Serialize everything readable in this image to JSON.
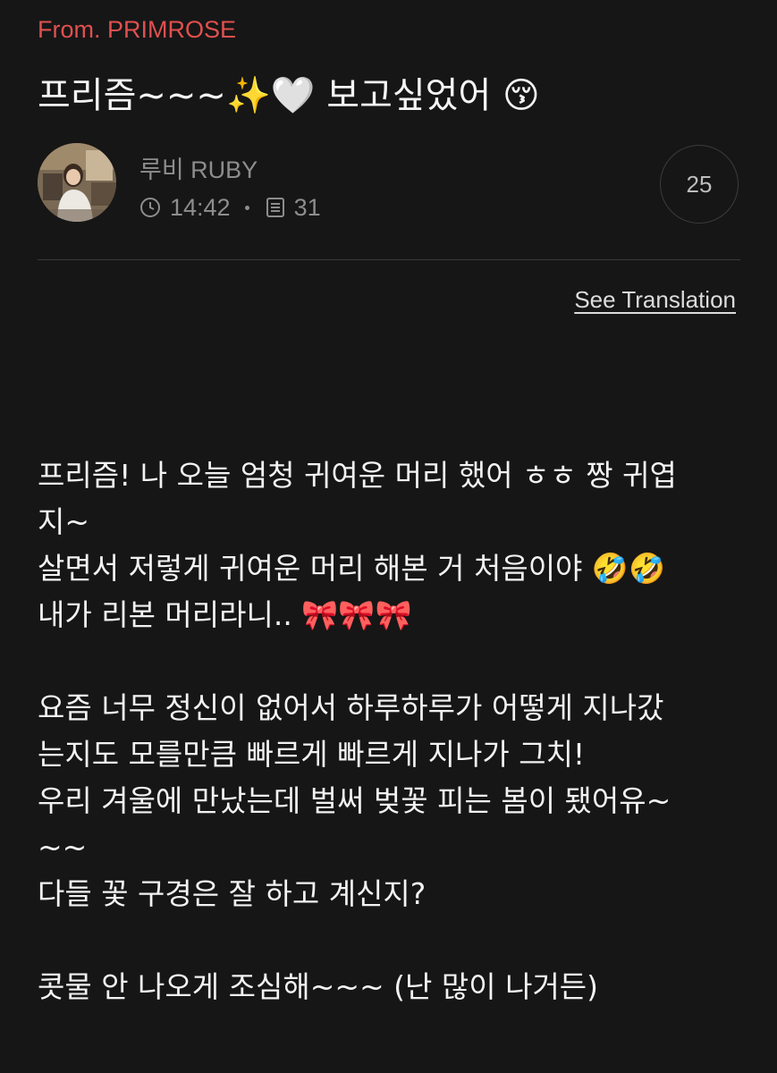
{
  "header": {
    "from_label": "From. PRIMROSE",
    "title": "프리즘~~~✨🤍 보고싶었어 😚"
  },
  "author": {
    "name": "루비 RUBY",
    "time": "14:42",
    "view_count": "31",
    "comment_count": "25"
  },
  "actions": {
    "translate_label": "See Translation"
  },
  "post": {
    "lines": [
      "프리즘! 나 오늘 엄청 귀여운 머리 했어 ㅎㅎ 짱 귀엽",
      "지~",
      "살면서 저렇게 귀여운 머리 해본 거 처음이야 🤣🤣",
      "내가 리본 머리라니.. 🎀🎀🎀",
      "",
      "요즘 너무 정신이 없어서 하루하루가 어떻게 지나갔",
      "는지도 모를만큼 빠르게 빠르게 지나가 그치!",
      "우리 겨울에 만났는데 벌써 벚꽃 피는 봄이 됐어유~",
      "~~",
      "다들 꽃 구경은 잘 하고 계신지?",
      "",
      "콧물 안 나오게 조심해~~~ (난 많이 나거든)"
    ]
  },
  "icons": {
    "time": "clock-icon",
    "views": "document-icon"
  },
  "colors": {
    "background": "#161616",
    "accent": "#e0504f",
    "muted": "#8d8d8d",
    "text": "#f2f2f2"
  }
}
